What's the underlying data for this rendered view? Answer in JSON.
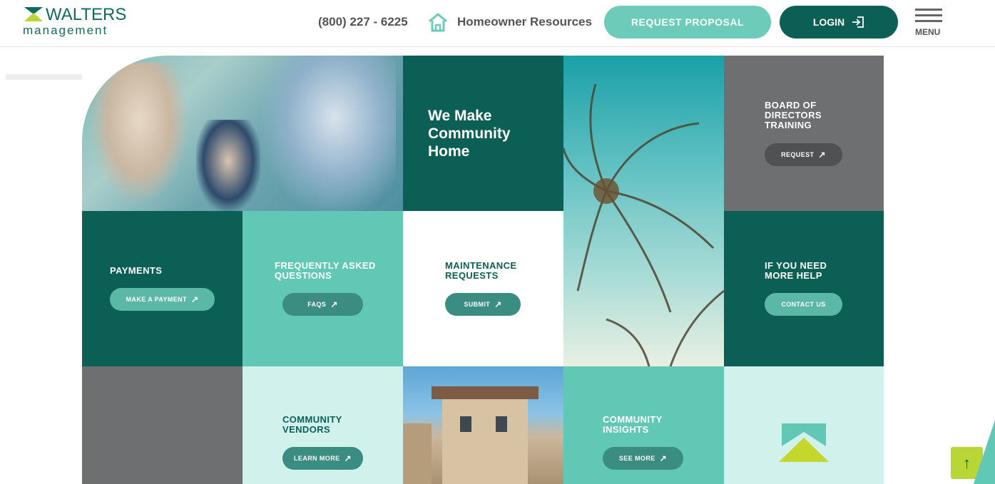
{
  "header": {
    "logo_top": "WALTERS",
    "logo_bottom": "management",
    "phone": "(800) 227 - 6225",
    "home_icon": "home-icon",
    "resources": "Homeowner Resources",
    "proposal_label": "REQUEST PROPOSAL",
    "login_label": "LOGIN",
    "menu_label": "MENU"
  },
  "hero": {
    "headline": "We Make Community Home"
  },
  "tiles": {
    "board": {
      "title": "BOARD OF DIRECTORS TRAINING",
      "button": "REQUEST"
    },
    "payments": {
      "title": "PAYMENTS",
      "button": "MAKE A PAYMENT"
    },
    "faq": {
      "title": "FREQUENTLY ASKED QUESTIONS",
      "button": "FAQS"
    },
    "maintenance": {
      "title": "MAINTENANCE REQUESTS",
      "button": "SUBMIT"
    },
    "help": {
      "title": "IF YOU NEED MORE HELP",
      "button": "CONTACT US"
    },
    "vendors": {
      "title": "COMMUNITY VENDORS",
      "button": "LEARN MORE"
    },
    "insights": {
      "title": "COMMUNITY INSIGHTS",
      "button": "SEE MORE"
    }
  },
  "colors": {
    "dark_teal": "#0c5f54",
    "mid_teal": "#62c8b6",
    "light_teal": "#d0f1ec",
    "gray": "#6e6f71",
    "lime": "#c5d62c"
  },
  "icons": {
    "external": "external-link-icon",
    "scroll_top": "arrow-up-icon"
  }
}
